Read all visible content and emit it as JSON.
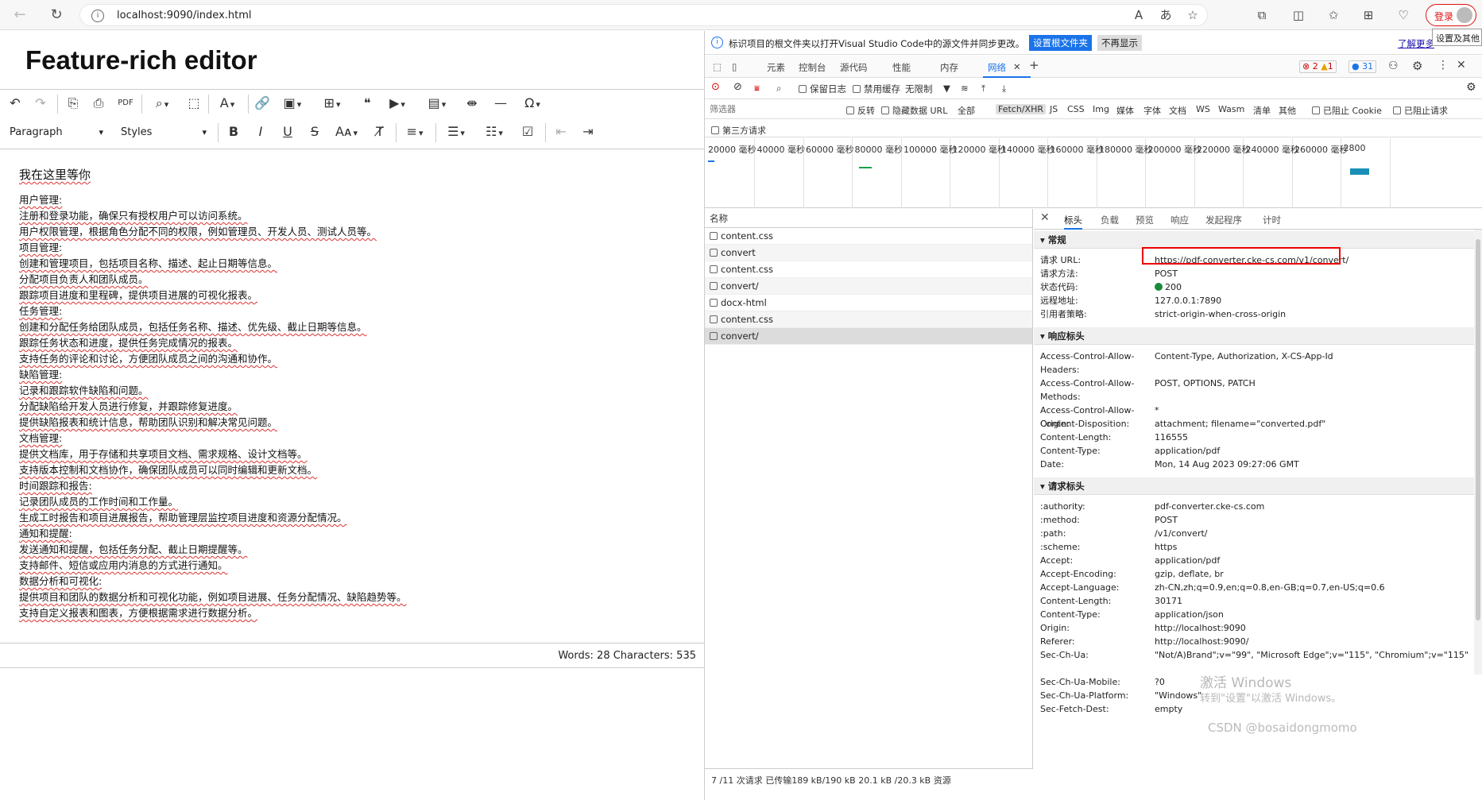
{
  "browser": {
    "url": "localhost:9090/index.html",
    "login_label": "登录",
    "tooltip": "设置及其他"
  },
  "editor": {
    "title": "Feature-rich editor",
    "paragraph_select": "Paragraph",
    "styles_select": "Styles",
    "heading": "我在这里等你",
    "lines": [
      "用户管理:",
      "注册和登录功能，确保只有授权用户可以访问系统。",
      "用户权限管理，根据角色分配不同的权限，例如管理员、开发人员、测试人员等。",
      "项目管理:",
      "创建和管理项目，包括项目名称、描述、起止日期等信息。",
      "分配项目负责人和团队成员。",
      "跟踪项目进度和里程碑，提供项目进展的可视化报表。",
      "任务管理:",
      "创建和分配任务给团队成员，包括任务名称、描述、优先级、截止日期等信息。",
      "跟踪任务状态和进度，提供任务完成情况的报表。",
      "支持任务的评论和讨论，方便团队成员之间的沟通和协作。",
      "缺陷管理:",
      "记录和跟踪软件缺陷和问题。",
      "分配缺陷给开发人员进行修复，并跟踪修复进度。",
      "提供缺陷报表和统计信息，帮助团队识别和解决常见问题。",
      "文档管理:",
      "提供文档库，用于存储和共享项目文档、需求规格、设计文档等。",
      "支持版本控制和文档协作，确保团队成员可以同时编辑和更新文档。",
      "时间跟踪和报告:",
      "记录团队成员的工作时间和工作量。",
      "生成工时报告和项目进展报告，帮助管理层监控项目进度和资源分配情况。",
      "通知和提醒:",
      "发送通知和提醒，包括任务分配、截止日期提醒等。",
      "支持邮件、短信或应用内消息的方式进行通知。",
      "数据分析和可视化:",
      "提供项目和团队的数据分析和可视化功能，例如项目进展、任务分配情况、缺陷趋势等。",
      "支持自定义报表和图表，方便根据需求进行数据分析。"
    ],
    "status": "Words: 28  Characters: 535"
  },
  "devtools": {
    "info_text": "标识项目的根文件夹以打开Visual Studio Code中的源文件并同步更改。",
    "set_root_button": "设置根文件夹",
    "no_more_button": "不再显示",
    "learn_more": "了解更多",
    "tabs": [
      "元素",
      "控制台",
      "源代码",
      "性能",
      "内存",
      "网络"
    ],
    "badges": {
      "errors": "2",
      "warnings": "1",
      "info": "31"
    },
    "net_toolbar": {
      "preserve_log": "保留日志",
      "disable_cache": "禁用缓存",
      "throttle": "无限制"
    },
    "filter_placeholder": "筛选器",
    "filter_opts": {
      "invert": "反转",
      "hide_data_url": "隐藏数据 URL",
      "all": "全部"
    },
    "filter_types": [
      "Fetch/XHR",
      "JS",
      "CSS",
      "Img",
      "媒体",
      "字体",
      "文档",
      "WS",
      "Wasm",
      "清单",
      "其他"
    ],
    "blocked_cookies": "已阻止 Cookie",
    "blocked_requests": "已阻止请求",
    "third_party": "第三方请求",
    "timeline_ticks": [
      "20000 毫秒",
      "40000 毫秒",
      "60000 毫秒",
      "80000 毫秒",
      "100000 毫秒",
      "120000 毫秒",
      "140000 毫秒",
      "160000 毫秒",
      "180000 毫秒",
      "200000 毫秒",
      "220000 毫秒",
      "240000 毫秒",
      "260000 毫秒",
      "2800"
    ],
    "name_header": "名称",
    "requests": [
      "content.css",
      "convert",
      "content.css",
      "convert/",
      "docx-html",
      "content.css",
      "convert/"
    ],
    "detail_tabs": [
      "标头",
      "负载",
      "预览",
      "响应",
      "发起程序",
      "计时"
    ],
    "general_title": "常规",
    "general": [
      {
        "k": "请求 URL:",
        "v": "https://pdf-converter.cke-cs.com/v1/convert/"
      },
      {
        "k": "请求方法:",
        "v": "POST"
      },
      {
        "k": "状态代码:",
        "v": "200"
      },
      {
        "k": "远程地址:",
        "v": "127.0.0.1:7890"
      },
      {
        "k": "引用者策略:",
        "v": "strict-origin-when-cross-origin"
      }
    ],
    "response_title": "响应标头",
    "response_headers": [
      {
        "k": "Access-Control-Allow-Headers:",
        "v": "Content-Type, Authorization, X-CS-App-Id"
      },
      {
        "k": "Access-Control-Allow-Methods:",
        "v": "POST, OPTIONS, PATCH"
      },
      {
        "k": "Access-Control-Allow-Origin:",
        "v": "*"
      },
      {
        "k": "Content-Disposition:",
        "v": "attachment; filename=\"converted.pdf\""
      },
      {
        "k": "Content-Length:",
        "v": "116555"
      },
      {
        "k": "Content-Type:",
        "v": "application/pdf"
      },
      {
        "k": "Date:",
        "v": "Mon, 14 Aug 2023 09:27:06 GMT"
      }
    ],
    "request_title": "请求标头",
    "request_headers": [
      {
        "k": ":authority:",
        "v": "pdf-converter.cke-cs.com"
      },
      {
        "k": ":method:",
        "v": "POST"
      },
      {
        "k": ":path:",
        "v": "/v1/convert/"
      },
      {
        "k": ":scheme:",
        "v": "https"
      },
      {
        "k": "Accept:",
        "v": "application/pdf"
      },
      {
        "k": "Accept-Encoding:",
        "v": "gzip, deflate, br"
      },
      {
        "k": "Accept-Language:",
        "v": "zh-CN,zh;q=0.9,en;q=0.8,en-GB;q=0.7,en-US;q=0.6"
      },
      {
        "k": "Content-Length:",
        "v": "30171"
      },
      {
        "k": "Content-Type:",
        "v": "application/json"
      },
      {
        "k": "Origin:",
        "v": "http://localhost:9090"
      },
      {
        "k": "Referer:",
        "v": "http://localhost:9090/"
      },
      {
        "k": "Sec-Ch-Ua:",
        "v": "\"Not/A)Brand\";v=\"99\", \"Microsoft Edge\";v=\"115\", \"Chromium\";v=\"115\""
      },
      {
        "k": "Sec-Ch-Ua-Mobile:",
        "v": "?0"
      },
      {
        "k": "Sec-Ch-Ua-Platform:",
        "v": "\"Windows\""
      },
      {
        "k": "Sec-Fetch-Dest:",
        "v": "empty"
      }
    ],
    "net_status": "7 /11 次请求  已传输189 kB/190 kB  20.1 kB /20.3 kB 资源"
  },
  "overlay": {
    "activate_windows": "激活 Windows",
    "activate_sub": "转到\"设置\"以激活 Windows。",
    "csdn": "CSDN @bosaidongmomo"
  }
}
